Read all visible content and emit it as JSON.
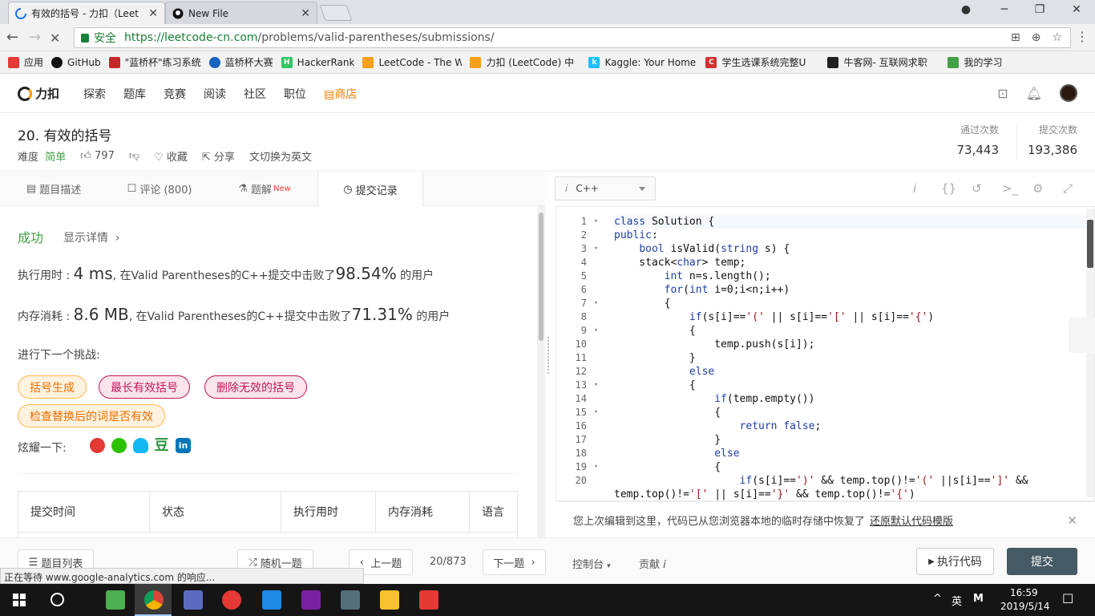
{
  "browser": {
    "tabs": [
      {
        "label": "有效的括号 - 力扣（Leet",
        "active": true
      },
      {
        "label": "New File",
        "active": false
      }
    ],
    "address": {
      "secure_label": "安全",
      "url_host": "https://leetcode-cn.com",
      "url_path": "/problems/valid-parentheses/submissions/"
    },
    "bookmarks": [
      {
        "label": "应用",
        "icon": "apps-grid-icon",
        "color": "#e53935"
      },
      {
        "label": "GitHub",
        "icon": "github-icon",
        "color": "#111111"
      },
      {
        "label": "\"蓝桥杯\"练习系统",
        "icon": "lanqiao-icon",
        "color": "#c62828"
      },
      {
        "label": "蓝桥杯大赛",
        "icon": "lanqiao-cup-icon",
        "color": "#1565c0"
      },
      {
        "label": "HackerRank",
        "icon": "hackerrank-icon",
        "color": "#2ec866"
      },
      {
        "label": "LeetCode - The Wo",
        "icon": "leetcode-icon",
        "color": "#f89f1b"
      },
      {
        "label": "力扣 (LeetCode) 中",
        "icon": "leetcode-cn-icon",
        "color": "#f89f1b"
      },
      {
        "label": "Kaggle: Your Home",
        "icon": "kaggle-icon",
        "color": "#20beff"
      },
      {
        "label": "学生选课系统完整U",
        "icon": "csdn-icon",
        "color": "#d32f2f"
      },
      {
        "label": "牛客网- 互联网求职",
        "icon": "nowcoder-icon",
        "color": "#222222"
      },
      {
        "label": "我的学习",
        "icon": "folder-green-icon",
        "color": "#43a047"
      }
    ]
  },
  "nav": {
    "brand": "力扣",
    "items": [
      "探索",
      "题库",
      "竞赛",
      "阅读",
      "社区",
      "职位"
    ],
    "store": "商店"
  },
  "problem": {
    "title": "20. 有效的括号",
    "difficulty_label": "难度",
    "difficulty": "简单",
    "likes": "797",
    "favorite": "收藏",
    "share": "分享",
    "switch_lang": "切换为英文",
    "accepted_label": "通过次数",
    "accepted_value": "73,443",
    "submissions_label": "提交次数",
    "submissions_value": "193,386"
  },
  "left_tabs": [
    {
      "label": "题目描述"
    },
    {
      "label": "评论 (800)"
    },
    {
      "label": "题解",
      "badge": "New"
    },
    {
      "label": "提交记录",
      "active": true
    }
  ],
  "result": {
    "status": "成功",
    "detail_link": "显示详情",
    "runtime_label": "执行用时 :",
    "runtime_value": "4 ms",
    "runtime_mid": ", 在Valid Parentheses的C++提交中击败了",
    "runtime_pct": "98.54%",
    "runtime_tail": " 的用户",
    "memory_label": "内存消耗 :",
    "memory_value": "8.6 MB",
    "memory_mid": ", 在Valid Parentheses的C++提交中击败了",
    "memory_pct": "71.31%",
    "memory_tail": " 的用户",
    "next_label": "进行下一个挑战:",
    "challenges": [
      "括号生成",
      "最长有效括号",
      "删除无效的括号",
      "检查替换后的词是否有效"
    ],
    "share_label": "炫耀一下:"
  },
  "table": {
    "headers": [
      "提交时间",
      "状态",
      "执行用时",
      "内存消耗",
      "语言"
    ]
  },
  "editor": {
    "language": "C++",
    "lines": [
      {
        "n": "1",
        "fold": true,
        "text": "class Solution {"
      },
      {
        "n": "2",
        "fold": false,
        "text": "public:"
      },
      {
        "n": "3",
        "fold": true,
        "text": "    bool isValid(string s) {"
      },
      {
        "n": "4",
        "fold": false,
        "text": "    stack<char> temp;"
      },
      {
        "n": "5",
        "fold": false,
        "text": "        int n=s.length();"
      },
      {
        "n": "6",
        "fold": false,
        "text": "        for(int i=0;i<n;i++)"
      },
      {
        "n": "7",
        "fold": true,
        "text": "        {"
      },
      {
        "n": "8",
        "fold": false,
        "text": "            if(s[i]=='(' || s[i]=='[' || s[i]=='{')"
      },
      {
        "n": "9",
        "fold": true,
        "text": "            {"
      },
      {
        "n": "10",
        "fold": false,
        "text": "                temp.push(s[i]);"
      },
      {
        "n": "11",
        "fold": false,
        "text": "            }"
      },
      {
        "n": "12",
        "fold": false,
        "text": "            else"
      },
      {
        "n": "13",
        "fold": true,
        "text": "            {"
      },
      {
        "n": "14",
        "fold": false,
        "text": "                if(temp.empty())"
      },
      {
        "n": "15",
        "fold": true,
        "text": "                {"
      },
      {
        "n": "16",
        "fold": false,
        "text": "                    return false;"
      },
      {
        "n": "17",
        "fold": false,
        "text": "                }"
      },
      {
        "n": "18",
        "fold": false,
        "text": "                else"
      },
      {
        "n": "19",
        "fold": true,
        "text": "                {"
      },
      {
        "n": "20",
        "fold": false,
        "text": "                    if(s[i]==')' && temp.top()!='(' ||s[i]==']' &&"
      },
      {
        "n": "",
        "fold": false,
        "text": "temp.top()!='[' || s[i]=='}' && temp.top()!='{')"
      }
    ],
    "restore_msg": "您上次编辑到这里，代码已从您浏览器本地的临时存储中恢复了",
    "restore_link": "还原默认代码模版"
  },
  "bottom": {
    "problem_list": "题目列表",
    "random": "随机一题",
    "prev": "上一题",
    "counter": "20/873",
    "next": "下一题",
    "console": "控制台",
    "contribute": "贡献",
    "run": "执行代码",
    "submit": "提交"
  },
  "status_text": "正在等待 www.google-analytics.com 的响应...",
  "taskbar": {
    "ime": "英",
    "ime2": "M",
    "time": "16:59",
    "date": "2019/5/14"
  },
  "colors": {
    "success": "#43a047",
    "store": "#f57c00",
    "submit_bg": "#455a64"
  }
}
